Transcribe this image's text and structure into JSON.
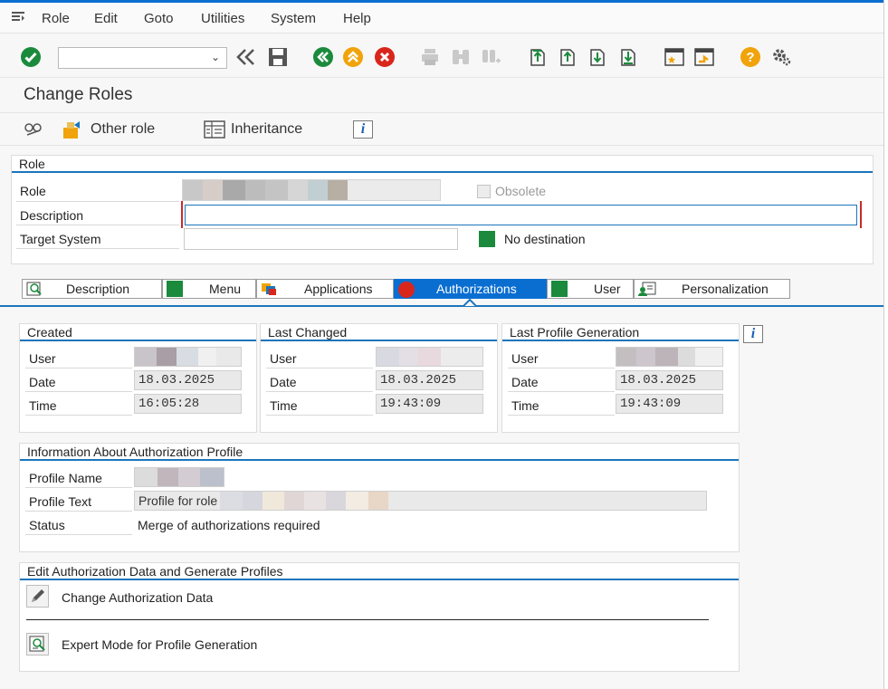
{
  "menu": {
    "items": [
      "Role",
      "Edit",
      "Goto",
      "Utilities",
      "System",
      "Help"
    ]
  },
  "page": {
    "title": "Change Roles"
  },
  "app_toolbar": {
    "other_role": "Other role",
    "inheritance": "Inheritance"
  },
  "role_group": {
    "title": "Role",
    "role_label": "Role",
    "description_label": "Description",
    "target_system_label": "Target System",
    "obsolete_label": "Obsolete",
    "no_destination_label": "No destination",
    "description_value": ""
  },
  "tabs": [
    "Description",
    "Menu",
    "Applications",
    "Authorizations",
    "User",
    "Personalization"
  ],
  "created": {
    "title": "Created",
    "user_label": "User",
    "date_label": "Date",
    "time_label": "Time",
    "date": "18.03.2025",
    "time": "16:05:28"
  },
  "last_changed": {
    "title": "Last Changed",
    "user_label": "User",
    "date_label": "Date",
    "time_label": "Time",
    "date": "18.03.2025",
    "time": "19:43:09"
  },
  "last_profile_generation": {
    "title": "Last Profile Generation",
    "user_label": "User",
    "date_label": "Date",
    "time_label": "Time",
    "date": "18.03.2025",
    "time": "19:43:09"
  },
  "profile_info": {
    "title": "Information About Authorization Profile",
    "profile_name_label": "Profile Name",
    "profile_text_label": "Profile Text",
    "status_label": "Status",
    "profile_text_value": "Profile for role",
    "status_value": "Merge of authorizations required"
  },
  "edit_auth": {
    "title": "Edit Authorization Data and Generate Profiles",
    "change_auth": "Change Authorization Data",
    "expert_mode": "Expert Mode for Profile Generation"
  },
  "colors": {
    "accent": "#0a6ed1",
    "green": "#1b8a3c",
    "orange": "#f0a30a",
    "red": "#d9261c"
  }
}
